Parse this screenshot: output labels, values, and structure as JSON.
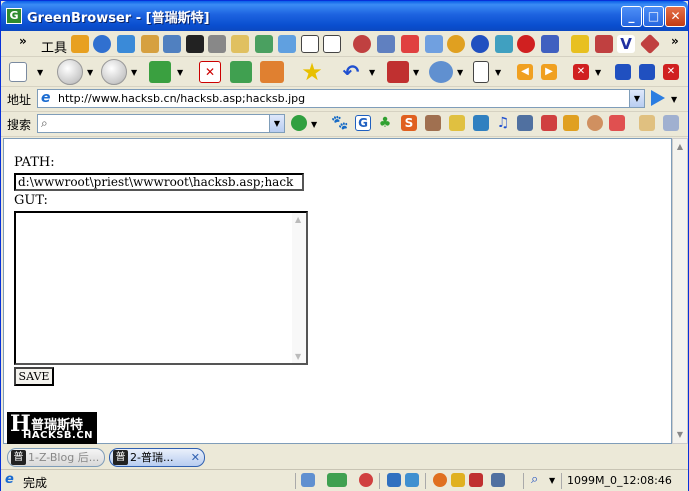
{
  "window": {
    "title": "GreenBrowser - [普瑞斯特]"
  },
  "menu": {
    "tools_label": "工具"
  },
  "address": {
    "label": "地址",
    "url": "http://www.hacksb.cn/hacksb.asp;hacksb.jpg"
  },
  "search": {
    "label": "搜索",
    "value": ""
  },
  "page": {
    "path_label": "PATH:",
    "path_value": "d:\\wwwroot\\priest\\wwwroot\\hacksb.asp;hack",
    "gut_label": "GUT:",
    "gut_value": "",
    "save_label": "SAVE",
    "logo_text": "普瑞斯特",
    "logo_url": "HACKSB.CN"
  },
  "tabs": [
    {
      "label": "1-Z-Blog 后...",
      "active": false
    },
    {
      "label": "2-普瑞...",
      "active": true
    }
  ],
  "status": {
    "text": "完成",
    "clock": "1099M_0_12:08:46"
  },
  "colors": {
    "titlebar": "#0a4fd0",
    "go_arrow": "#2a7de1"
  }
}
